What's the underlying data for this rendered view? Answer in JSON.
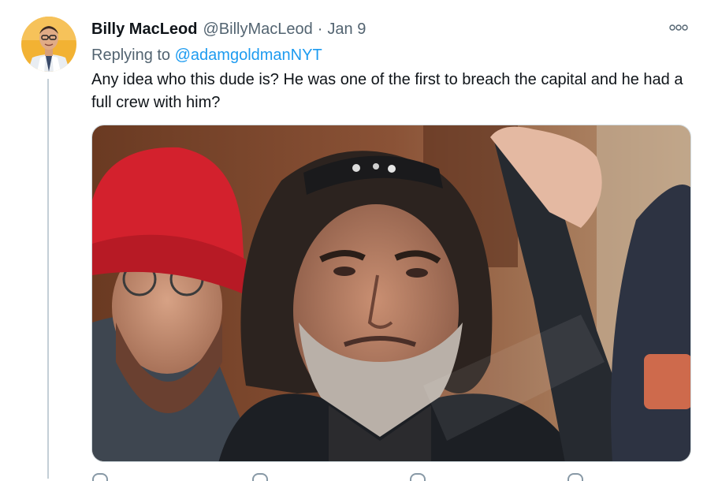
{
  "tweet": {
    "display_name": "Billy MacLeod",
    "handle": "@BillyMacLeod",
    "separator": "·",
    "date": "Jan 9",
    "replying_prefix": "Replying to",
    "replying_handle": "@adamgoldmanNYT",
    "text": "Any idea who this dude is? He was one of the first to breach the capital and he had a full crew with him?"
  },
  "icons": {
    "more": "more-horizontal-icon"
  },
  "colors": {
    "link": "#1d9bf0",
    "secondary_text": "#536471",
    "primary_text": "#0f1419",
    "thread_line": "#c4cfd6"
  }
}
